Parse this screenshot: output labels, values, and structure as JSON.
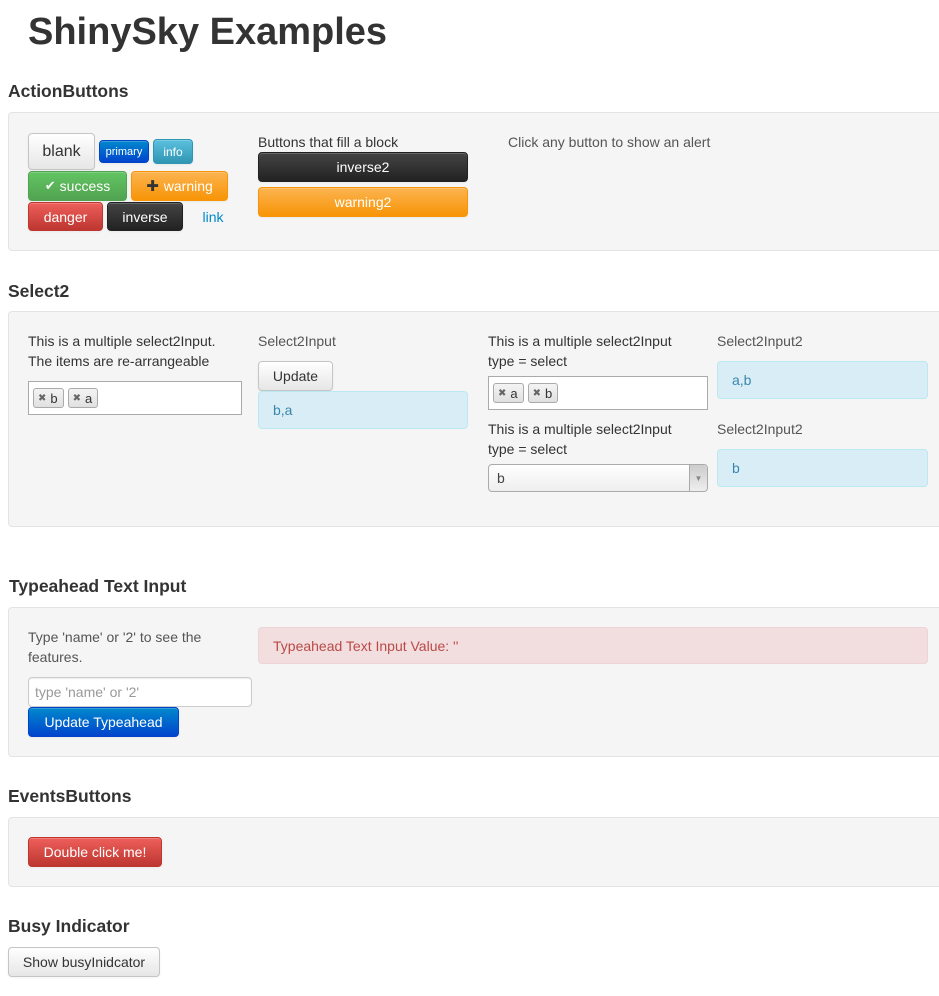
{
  "page_title": "ShinySky Examples",
  "action_buttons": {
    "heading": "ActionButtons",
    "blank": "blank",
    "primary": "primary",
    "info": "info",
    "success": "success",
    "warning": "warning",
    "danger": "danger",
    "inverse": "inverse",
    "link": "link",
    "block_label": "Buttons that fill a block",
    "inverse2": "inverse2",
    "warning2": "warning2",
    "hint": "Click any button to show an alert"
  },
  "select2": {
    "heading": "Select2",
    "col1_line1": "This is a multiple select2Input.",
    "col1_line2": "The items are re-arrangeable",
    "col1_chips": [
      "b",
      "a"
    ],
    "col2_label": "Select2Input",
    "update_button": "Update",
    "col2_value": "b,a",
    "col3a_line1": "This is a multiple select2Input",
    "col3a_line2": "type = select",
    "col3a_chips": [
      "a",
      "b"
    ],
    "col4a_label": "Select2Input2",
    "col4a_value": "a,b",
    "col3b_line1": "This is a multiple select2Input",
    "col3b_line2": "type = select",
    "col3b_selected": "b",
    "col4b_label": "Select2Input2",
    "col4b_value": "b"
  },
  "typeahead": {
    "heading": "Typeahead Text Input",
    "desc_line1": "Type 'name' or '2' to see the",
    "desc_line2": "features.",
    "placeholder": "type 'name' or '2'",
    "update_button": "Update Typeahead",
    "value_text": "Typeahead Text Input Value: ''"
  },
  "events_buttons": {
    "heading": "EventsButtons",
    "double_click": "Double click me!"
  },
  "busy": {
    "heading": "Busy Indicator",
    "button": "Show busyInidcator"
  },
  "icons": {
    "success_icon": "check-icon",
    "warning_icon": "plus-icon",
    "chip_remove": "remove-x-icon",
    "select_arrow": "chevron-down-icon"
  }
}
